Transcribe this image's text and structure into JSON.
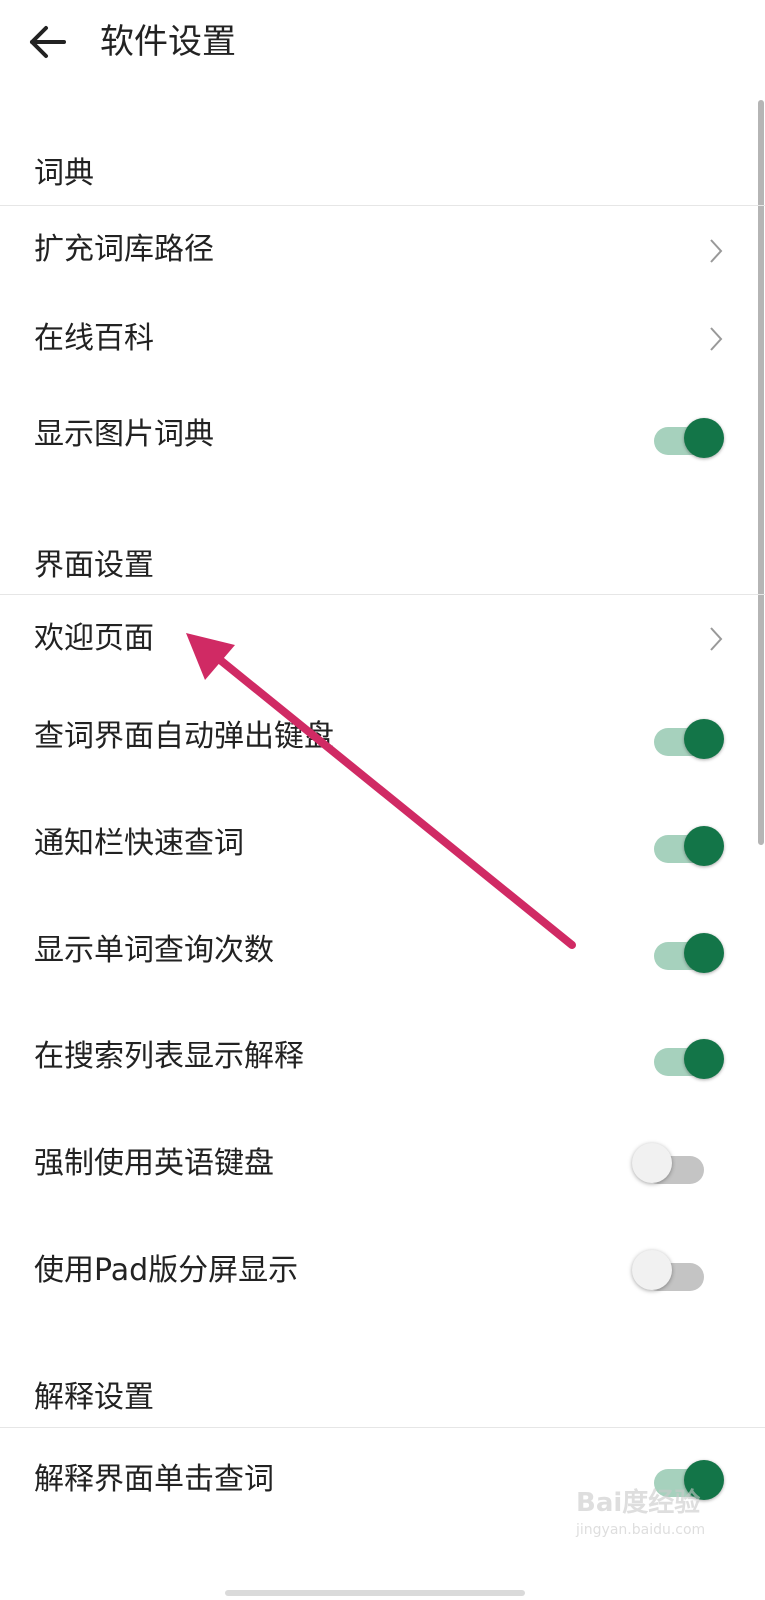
{
  "header": {
    "title": "软件设置"
  },
  "sections": [
    {
      "title": "词典",
      "items": [
        {
          "label": "扩充词库路径",
          "kind": "chevron"
        },
        {
          "label": "在线百科",
          "kind": "chevron"
        },
        {
          "label": "显示图片词典",
          "kind": "switch",
          "on": true
        }
      ]
    },
    {
      "title": "界面设置",
      "items": [
        {
          "label": "欢迎页面",
          "kind": "chevron"
        },
        {
          "label": "查词界面自动弹出键盘",
          "kind": "switch",
          "on": true
        },
        {
          "label": "通知栏快速查词",
          "kind": "switch",
          "on": true
        },
        {
          "label": "显示单词查询次数",
          "kind": "switch",
          "on": true
        },
        {
          "label": "在搜索列表显示解释",
          "kind": "switch",
          "on": true
        },
        {
          "label": "强制使用英语键盘",
          "kind": "switch",
          "on": false
        },
        {
          "label": "使用Pad版分屏显示",
          "kind": "switch",
          "on": false
        }
      ]
    },
    {
      "title": "解释设置",
      "items": [
        {
          "label": "解释界面单击查词",
          "kind": "switch",
          "on": true
        }
      ]
    }
  ],
  "colors": {
    "switch_on_knob": "#137548",
    "switch_on_track": "#a6d1bd",
    "annotation_arrow": "#d02a64"
  },
  "icons": {
    "back": "arrow-left-icon",
    "chevron": "chevron-right-icon"
  },
  "watermark": {
    "text": "Bai度经验",
    "sub": "jingyan.baidu.com"
  }
}
